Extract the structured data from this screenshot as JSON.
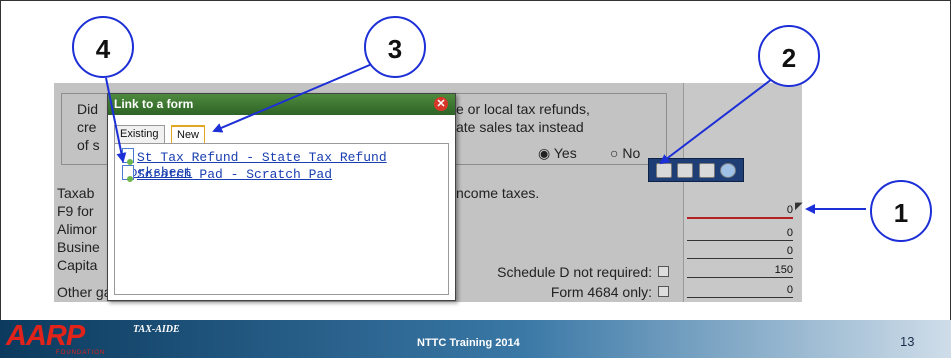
{
  "dialog": {
    "title": "Link to a form",
    "close_glyph": "✕",
    "tabs": [
      {
        "label": "Existing"
      },
      {
        "label": "New"
      }
    ],
    "links": [
      {
        "label": "St Tax Refund - State Tax Refund Worksheet"
      },
      {
        "label": "Scratch Pad - Scratch Pad"
      }
    ]
  },
  "question": {
    "line1_start": "Did",
    "line2_start": "cre",
    "line3_start": "of s",
    "line1_end": "e or local tax refunds,",
    "line2_end": "ate sales tax instead",
    "yes_label": "Yes",
    "no_label": "No",
    "yes_glyph": "◉",
    "no_glyph": "○"
  },
  "rows": {
    "taxable_partial": "Taxab",
    "taxable_end": "ncome taxes.",
    "f9_partial": "F9 for",
    "alimony_partial": "Alimor",
    "business_partial": "Busine",
    "capital_partial": "Capita",
    "other_gains": "Other gains or  (losses)",
    "schedule_d": "Schedule D not required:",
    "form_4684": "Form 4684 only:"
  },
  "fields": [
    "0",
    "0",
    "0",
    "150",
    "0"
  ],
  "callouts": [
    "1",
    "2",
    "3",
    "4"
  ],
  "footer": {
    "logo": "AARP",
    "logo_sub": "TAX-AIDE",
    "logo_foundation": "FOUNDATION",
    "title": "NTTC Training 2014",
    "page_number": "13"
  },
  "colors": {
    "callout_blue": "#1d2fd6",
    "dialog_title_green": "#2e6426",
    "link_blue": "#1a3fb0",
    "aarp_red": "#e2231a"
  }
}
